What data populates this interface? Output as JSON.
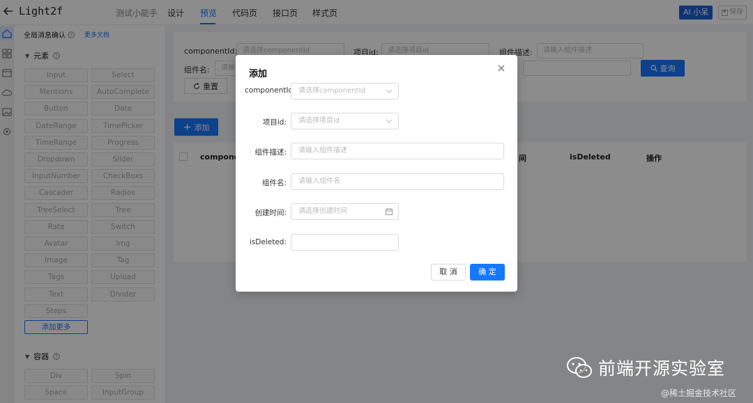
{
  "app": {
    "title": "Light2f",
    "tabs": [
      {
        "label": "测试小能手",
        "state": "muted"
      },
      {
        "label": "设计",
        "state": "normal"
      },
      {
        "label": "预览",
        "state": "active"
      },
      {
        "label": "代码页",
        "state": "normal"
      },
      {
        "label": "接口页",
        "state": "normal"
      },
      {
        "label": "样式页",
        "state": "normal"
      }
    ],
    "ai_label": "AI 小呆",
    "save_label": "保存"
  },
  "panel": {
    "header": "全局消息确认",
    "more_docs": "更多文档",
    "elements_title": "元素",
    "elements": [
      "Input",
      "Select",
      "Mentions",
      "AutoComplete",
      "Button",
      "Date",
      "DateRange",
      "TimePicker",
      "TimeRange",
      "Progress",
      "Dropdown",
      "Slider",
      "InputNumber",
      "CheckBoxs",
      "Cascader",
      "Radios",
      "TreeSelect",
      "Tree",
      "Rate",
      "Switch",
      "Avatar",
      "Img",
      "Image",
      "Tag",
      "Tags",
      "Upload",
      "Text",
      "Divider",
      "Steps"
    ],
    "add_more": "添加更多",
    "container_title": "容器",
    "containers": [
      "Div",
      "Spin",
      "Space",
      "InputGroup"
    ]
  },
  "search": {
    "componentId_label": "componentId:",
    "componentId_placeholder": "请选择componentId",
    "projectId_label": "项目id:",
    "projectId_placeholder": "请选择项目id",
    "desc_label": "组件描述:",
    "desc_placeholder": "请输入组件描述",
    "name_label": "组件名:",
    "name_placeholder": "请输",
    "query_label": "查询",
    "reset_label": "重置"
  },
  "table": {
    "add_label": "添加",
    "columns": [
      "componen",
      "间",
      "isDeleted",
      "操作"
    ]
  },
  "modal": {
    "title": "添加",
    "fields": [
      {
        "label": "componentIc",
        "placeholder": "请选择componentId",
        "type": "select"
      },
      {
        "label": "项目id:",
        "placeholder": "请选择项目id",
        "type": "select"
      },
      {
        "label": "组件描述:",
        "placeholder": "请输入组件描述",
        "type": "text"
      },
      {
        "label": "组件名:",
        "placeholder": "请输入组件名",
        "type": "text"
      },
      {
        "label": "创建时间:",
        "placeholder": "请选择创建时间",
        "type": "date"
      },
      {
        "label": "isDeleted:",
        "placeholder": "",
        "type": "text"
      }
    ],
    "cancel_label": "取 消",
    "ok_label": "确 定"
  },
  "watermark": {
    "main": "前端开源实验室",
    "sub": "@稀土掘金技术社区"
  },
  "colors": {
    "primary": "#1677ff",
    "overlay": "rgba(0,0,0,0.45)"
  }
}
